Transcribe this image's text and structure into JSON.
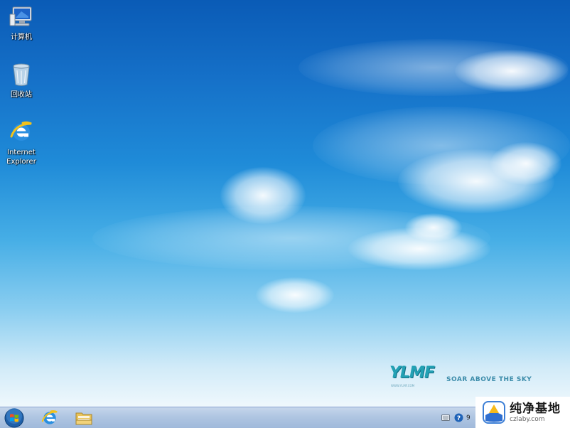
{
  "desktop": {
    "icons": [
      {
        "label": "计算机",
        "icon": "computer-icon"
      },
      {
        "label": "回收站",
        "icon": "recycle-bin-icon"
      },
      {
        "label": "Internet\nExplorer",
        "icon": "internet-explorer-icon"
      }
    ]
  },
  "wallpaper": {
    "logo_text": "YLMF",
    "tagline": "SOAR ABOVE THE SKY",
    "logo_small_text": "WWW.YLMF.COM",
    "colors": {
      "sky_top": "#0a5bb6",
      "sky_mid": "#46aee6",
      "sky_bottom": "#ffffff",
      "logo": "#23a1b4"
    }
  },
  "taskbar": {
    "start_icon": "windows-start-orb-icon",
    "pinned": [
      {
        "name": "Internet Explorer",
        "icon": "internet-explorer-icon"
      },
      {
        "name": "Windows Explorer",
        "icon": "folder-icon"
      }
    ],
    "tray": {
      "icons": [
        "keyboard-icon",
        "help-icon"
      ],
      "clock_fragment": "9"
    },
    "colors": {
      "taskbar_top": "#c7d7ec",
      "taskbar_bottom": "#9fb8da"
    }
  },
  "watermark": {
    "title": "纯净基地",
    "url": "czlaby.com",
    "icon": "czlaby-logo-icon"
  }
}
